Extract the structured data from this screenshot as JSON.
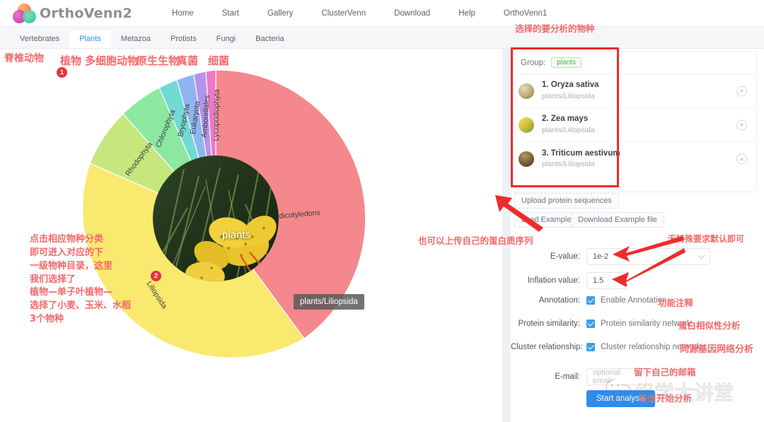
{
  "navbar": {
    "logo_text": "OrthoVenn2",
    "links": [
      "Home",
      "Start",
      "Gallery",
      "ClusterVenn",
      "Download",
      "Help",
      "OrthoVenn1"
    ]
  },
  "tabs": [
    {
      "label": "Vertebrates",
      "active": false
    },
    {
      "label": "Plants",
      "active": true
    },
    {
      "label": "Metazoa",
      "active": false
    },
    {
      "label": "Protists",
      "active": false
    },
    {
      "label": "Fungi",
      "active": false
    },
    {
      "label": "Bacteria",
      "active": false
    }
  ],
  "annotations": {
    "vertebrates_cn": "脊椎动物",
    "plants_cn": "植物",
    "metazoa_cn": "多细胞动物",
    "protists_cn": "原生生物",
    "fungi_cn": "真菌",
    "bacteria_cn": "细菌",
    "left_block": "点击相应物种分类\n即可进入对应的下\n一级物种目录，这里\n我们选择了\n植物—单子叶植物—\n选择了小麦、玉米、水稻\n3个物种",
    "top_right": "选择的要分析的物种",
    "upload_hint": "也可以上传自己的蛋白质序列",
    "default_hint": "无特殊要求默认即可",
    "annotation_hint": "功能注释",
    "protein_similarity_hint": "蛋白相似性分析",
    "cluster_hint": "同源基因网络分析",
    "email_hint": "留下自己的邮箱",
    "start_hint": "点击开始分析",
    "badge_1": "1",
    "badge_2": "2"
  },
  "chart_data": {
    "type": "pie",
    "title": "plants",
    "center_label": "plants",
    "tooltip": "plants/Liliopsida",
    "categories": [
      "eudicotyledons",
      "Liliopsida",
      "Rhodophyta",
      "Chlorophyta",
      "Bryophyta",
      "Eukaryota",
      "Amborellales",
      "Lycopodiophyta"
    ],
    "values": [
      33,
      30,
      12,
      8,
      5,
      4.5,
      4,
      3.5
    ],
    "colors": [
      "#f4888d",
      "#fae96f",
      "#c6e77e",
      "#8ce8a0",
      "#72d9d4",
      "#8fb5f0",
      "#b493ea",
      "#ef78c8"
    ],
    "legend": "none",
    "grid": false
  },
  "species_panel": {
    "group_label": "Group:",
    "group_value": "plants",
    "remove_icon": "×",
    "items": [
      {
        "index": "1.",
        "name": "Oryza sativa",
        "path": "plants/Liliopsida"
      },
      {
        "index": "2.",
        "name": "Zea mays",
        "path": "plants/Liliopsida"
      },
      {
        "index": "3.",
        "name": "Triticum aestivum",
        "path": "plants/Liliopsida"
      }
    ]
  },
  "buttons": {
    "upload": "Upload protein sequences",
    "load_example": "Load Example",
    "download_example": "Download Example file",
    "start_analysis": "Start analysis"
  },
  "form": {
    "evalue_label": "E-value:",
    "evalue_value": "1e-2",
    "inflation_label": "Inflation value:",
    "inflation_value": "1.5",
    "annotation_label": "Annotation:",
    "annotation_checkbox": "Enable Annotation",
    "protein_similarity_label": "Protein similarity:",
    "protein_similarity_checkbox": "Protein similarity network",
    "cluster_label": "Cluster relationship:",
    "cluster_checkbox": "Cluster relationship network",
    "email_label": "E-mail:",
    "email_placeholder": "optional email",
    "email_value": ""
  },
  "watermark": {
    "text": "组学大讲堂"
  },
  "colors": {
    "accent_blue": "#2f8ced",
    "annotation_red": "#f4696b",
    "box_red": "#ee2b2b",
    "tag_green": "#4fae4f"
  }
}
